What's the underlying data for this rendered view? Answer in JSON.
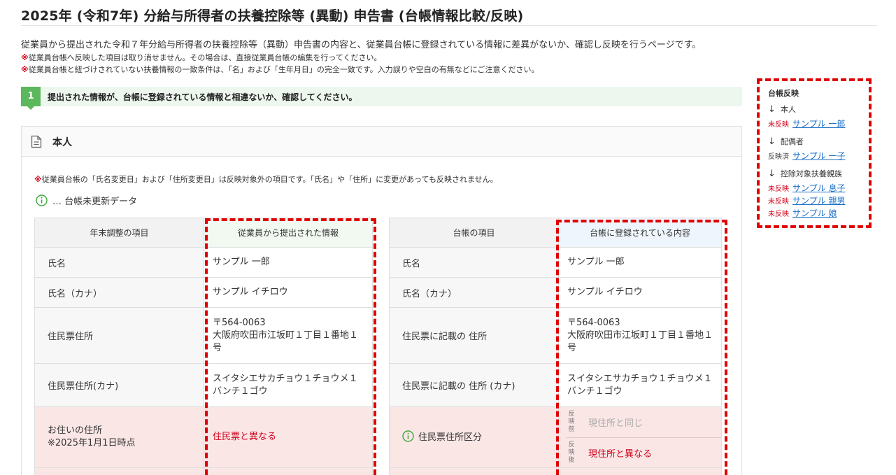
{
  "header": {
    "title": "2025年 (令和7年) 分給与所得者の扶養控除等 (異動) 申告書 (台帳情報比較/反映)",
    "description": "従業員から提出された令和７年分給与所得者の扶養控除等（異動）申告書の内容と、従業員台帳に登録されている情報に差異がないか、確認し反映を行うページです。",
    "note_mark": "※",
    "note1": "従業員台帳へ反映した項目は取り消せません。その場合は、直接従業員台帳の編集を行ってください。",
    "note2": "従業員台帳と紐づけされていない扶養情報の一致条件は、「名」および「生年月日」の完全一致です。入力誤りや空白の有無などにご注意ください。"
  },
  "step": {
    "number": "1",
    "text": "提出された情報が、台帳に登録されている情報と相違ないか、確認してください。"
  },
  "panel": {
    "title": "本人",
    "note": "従業員台帳の「氏名変更日」および「住所変更日」は反映対象外の項目です。「氏名」や「住所」に変更があっても反映されません。",
    "legend": "… 台帳未更新データ"
  },
  "left_table": {
    "headers": [
      "年末調整の項目",
      "従業員から提出された情報"
    ],
    "rows": [
      {
        "label": "氏名",
        "value": "サンプル 一郎"
      },
      {
        "label": "氏名（カナ）",
        "value": "サンプル イチロウ"
      },
      {
        "label": "住民票住所",
        "value_line1": "〒564-0063",
        "value_line2": "大阪府吹田市江坂町１丁目１番地１",
        "value_line3": "号"
      },
      {
        "label": "住民票住所(カナ)",
        "value_line1": "スイタシエサカチョウ１チョウメ１",
        "value_line2": "バンチ１ゴウ"
      },
      {
        "label_line1": "お住いの住所",
        "label_line2": "※2025年1月1日時点",
        "value": "住民票と異なる"
      }
    ]
  },
  "right_table": {
    "headers": [
      "台帳の項目",
      "台帳に登録されている内容"
    ],
    "rows": [
      {
        "label": "氏名",
        "value": "サンプル 一郎"
      },
      {
        "label": "氏名（カナ）",
        "value": "サンプル イチロウ"
      },
      {
        "label": "住民票に記載の 住所",
        "value_line1": "〒564-0063",
        "value_line2": "大阪府吹田市江坂町１丁目１番地１",
        "value_line3": "号"
      },
      {
        "label": "住民票に記載の 住所 (カナ)",
        "value_line1": "スイタシエサカチョウ１チョウメ１",
        "value_line2": "バンチ１ゴウ"
      },
      {
        "label": "住民票住所区分",
        "before_tag": "反映前",
        "before_value": "現住所と同じ",
        "after_tag": "反映後",
        "after_value": "現住所と異なる"
      }
    ]
  },
  "sidebar": {
    "title": "台帳反映",
    "groups": [
      {
        "label": "本人",
        "entries": [
          {
            "status": "未反映",
            "name": "サンプル 一郎"
          }
        ]
      },
      {
        "label": "配偶者",
        "entries": [
          {
            "status": "反映済",
            "name": "サンプル 一子"
          }
        ]
      },
      {
        "label": "控除対象扶養親族",
        "entries": [
          {
            "status": "未反映",
            "name": "サンプル 息子"
          },
          {
            "status": "未反映",
            "name": "サンプル 親男"
          },
          {
            "status": "未反映",
            "name": "サンプル 娘"
          }
        ]
      }
    ],
    "arrow": "↓"
  },
  "colors": {
    "accent_green": "#5cb85c",
    "warning_red": "#d0021b",
    "diff_row_bg": "#fbe6e6",
    "link_blue": "#1a6fc8",
    "dashed_highlight": "#e00000"
  },
  "icons": [
    "doc-icon",
    "info-icon",
    "arrow-down-icon"
  ]
}
